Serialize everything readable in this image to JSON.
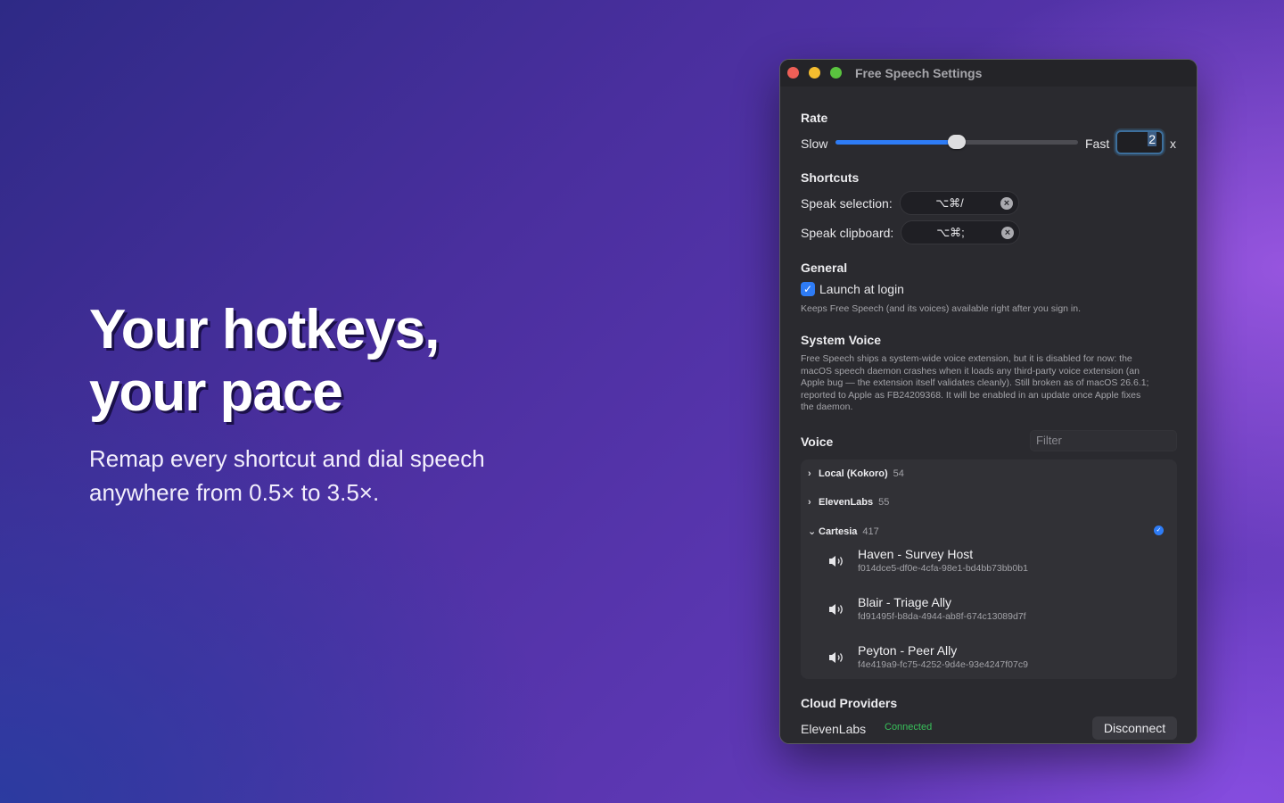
{
  "hero": {
    "title_line1": "Your hotkeys,",
    "title_line2": "your pace",
    "subtitle_line1": "Remap every shortcut and dial speech",
    "subtitle_line2": "anywhere from 0.5× to 3.5×."
  },
  "window": {
    "title": "Free Speech Settings"
  },
  "rate": {
    "heading": "Rate",
    "slow_label": "Slow",
    "fast_label": "Fast",
    "value": "2",
    "unit": "x",
    "slider_fraction": 0.5
  },
  "shortcuts": {
    "heading": "Shortcuts",
    "speak_selection_label": "Speak selection:",
    "speak_selection_keys": "⌥⌘/",
    "speak_clipboard_label": "Speak clipboard:",
    "speak_clipboard_keys": "⌥⌘;"
  },
  "general": {
    "heading": "General",
    "launch_label": "Launch at login",
    "launch_checked": true,
    "launch_help": "Keeps Free Speech (and its voices) available right after you sign in."
  },
  "system_voice": {
    "heading": "System Voice",
    "line1": "Free Speech ships a system-wide voice extension, but it is disabled for now: the",
    "line2": "macOS speech daemon crashes when it loads any third-party voice extension (an",
    "line3": "Apple bug — the extension itself validates cleanly). Still broken as of macOS 26.6.1;",
    "line4": "reported to Apple as FB24209368. It will be enabled in an update once Apple fixes",
    "line5": "the daemon."
  },
  "voice": {
    "heading": "Voice",
    "filter_placeholder": "Filter",
    "groups": [
      {
        "name": "Local (Kokoro)",
        "count": "54",
        "expanded": false
      },
      {
        "name": "ElevenLabs",
        "count": "55",
        "expanded": false
      },
      {
        "name": "Cartesia",
        "count": "417",
        "expanded": true
      }
    ],
    "items": [
      {
        "name": "Haven - Survey Host",
        "id": "f014dce5-df0e-4cfa-98e1-bd4bb73bb0b1"
      },
      {
        "name": "Blair - Triage Ally",
        "id": "fd91495f-b8da-4944-ab8f-674c13089d7f"
      },
      {
        "name": "Peyton - Peer Ally",
        "id": "f4e419a9-fc75-4252-9d4e-93e4247f07c9"
      }
    ]
  },
  "cloud": {
    "heading": "Cloud Providers",
    "provider": "ElevenLabs",
    "status": "Connected",
    "disconnect_label": "Disconnect"
  },
  "colors": {
    "accent": "#2e7cf6",
    "connected": "#38c15a"
  }
}
